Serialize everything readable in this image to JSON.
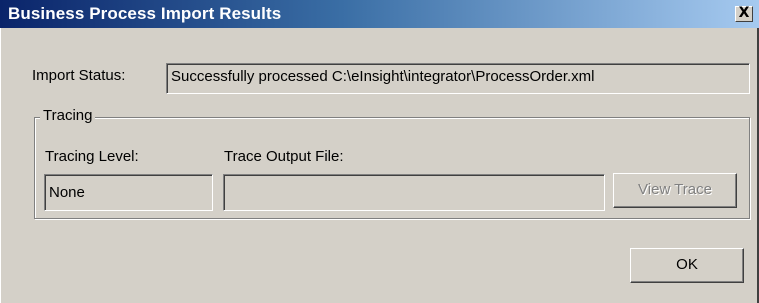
{
  "window": {
    "title": "Business Process Import Results",
    "close_glyph": "X"
  },
  "import_status": {
    "label": "Import Status:",
    "value": "Successfully processed C:\\eInsight\\integrator\\ProcessOrder.xml"
  },
  "tracing": {
    "group_label": "Tracing",
    "level_label": "Tracing Level:",
    "level_value": "None",
    "output_label": "Trace Output File:",
    "output_value": "",
    "view_trace_label": "View Trace"
  },
  "buttons": {
    "ok_label": "OK"
  },
  "colors": {
    "dialog_bg": "#d4d0c8",
    "titlebar_start": "#0a246a",
    "titlebar_end": "#a6caf0",
    "disabled_text": "#808080"
  },
  "icons": {
    "close": "close-icon"
  }
}
